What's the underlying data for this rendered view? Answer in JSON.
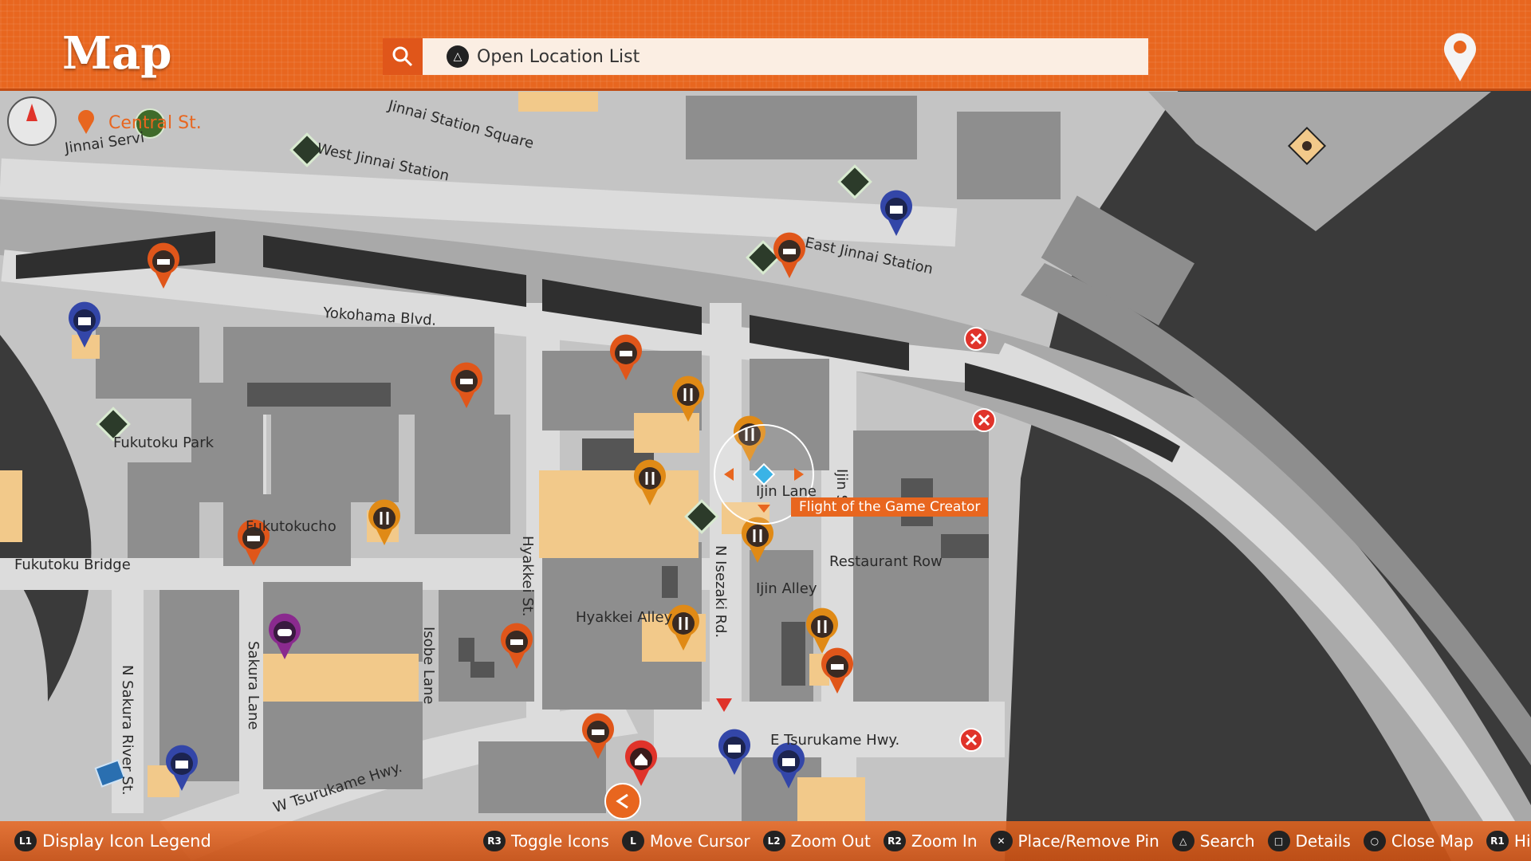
{
  "header": {
    "title": "Map",
    "search_label": "Open Location List",
    "search_button_glyph": "△"
  },
  "current_location": "Central St.",
  "destination_label": "Flight of the Game Creator",
  "streets": {
    "jinnai_station_square": "Jinnai Station Square",
    "west_jinnai_station": "West Jinnai Station",
    "east_jinnai_station": "East Jinnai Station",
    "jinnai_service": "Jinnai Servi",
    "yokohama_blvd": "Yokohama Blvd.",
    "fukutoku_park": "Fukutoku Park",
    "fukutokucho": "Fukutokucho",
    "fukutoku_bridge": "Fukutoku Bridge",
    "hyakkei_st": "Hyakkei St.",
    "hyakkei_alley": "Hyakkei Alley",
    "n_isezaki_rd": "N Isezaki Rd.",
    "ijin_lane": "Ijin Lane",
    "ijin_st": "Ijin St.",
    "restaurant_row": "Restaurant Row",
    "ijin_alley": "Ijin Alley",
    "sakura_lane": "Sakura Lane",
    "isobe_lane": "Isobe Lane",
    "n_sakura_river_st": "N Sakura River St.",
    "e_tsurukame_hwy": "E Tsurukame Hwy.",
    "w_tsurukame_hwy": "W Tsurukame Hwy."
  },
  "footer": {
    "legend": {
      "glyph": "L1",
      "label": "Display Icon Legend"
    },
    "controls": [
      {
        "glyph": "R3",
        "label": "Toggle Icons"
      },
      {
        "glyph": "L",
        "label": "Move Cursor"
      },
      {
        "glyph": "L2",
        "label": "Zoom Out"
      },
      {
        "glyph": "R2",
        "label": "Zoom In"
      },
      {
        "glyph": "✕",
        "label": "Place/Remove Pin"
      },
      {
        "glyph": "△",
        "label": "Search"
      },
      {
        "glyph": "□",
        "label": "Details"
      },
      {
        "glyph": "○",
        "label": "Close Map"
      },
      {
        "glyph": "R1",
        "label": "Hide Controls"
      }
    ]
  },
  "colors": {
    "accent": "#e8661f",
    "water": "#3a3a3a",
    "land": "#c4c4c4",
    "road": "#dcdcdc",
    "building": "#8e8e8e",
    "highlight_building": "#f2c98a",
    "pin_shop": "#3346a8",
    "pin_restaurant": "#e08a16",
    "pin_taxi": "#e0561a",
    "pin_game": "#8a2a8e",
    "pin_talk": "#d8ead0",
    "no_entry": "#e0332a"
  },
  "pins": [
    {
      "type": "taxi",
      "icon": "taxi-icon"
    },
    {
      "type": "taxi",
      "icon": "taxi-icon"
    },
    {
      "type": "taxi",
      "icon": "taxi-icon"
    },
    {
      "type": "taxi",
      "icon": "taxi-icon"
    },
    {
      "type": "taxi",
      "icon": "taxi-icon"
    },
    {
      "type": "taxi",
      "icon": "taxi-icon"
    },
    {
      "type": "taxi",
      "icon": "taxi-icon"
    },
    {
      "type": "taxi",
      "icon": "taxi-icon"
    },
    {
      "type": "restaurant",
      "icon": "fork-knife-icon"
    },
    {
      "type": "restaurant",
      "icon": "fork-knife-icon"
    },
    {
      "type": "restaurant",
      "icon": "fork-knife-icon"
    },
    {
      "type": "restaurant",
      "icon": "fork-knife-icon"
    },
    {
      "type": "restaurant",
      "icon": "fork-knife-icon"
    },
    {
      "type": "restaurant",
      "icon": "fork-knife-icon"
    },
    {
      "type": "restaurant",
      "icon": "fork-knife-icon"
    },
    {
      "type": "shop",
      "icon": "basket-icon"
    },
    {
      "type": "shop",
      "icon": "basket-icon"
    },
    {
      "type": "shop",
      "icon": "basket-icon"
    },
    {
      "type": "shop",
      "icon": "basket-icon"
    },
    {
      "type": "shop",
      "icon": "basket-icon"
    },
    {
      "type": "game",
      "icon": "gamepad-icon"
    },
    {
      "type": "home",
      "icon": "house-icon"
    },
    {
      "type": "talk",
      "icon": "speech-bubble-icon"
    },
    {
      "type": "talk",
      "icon": "speech-bubble-icon"
    },
    {
      "type": "talk",
      "icon": "speech-bubble-icon"
    },
    {
      "type": "talk",
      "icon": "speech-bubble-icon"
    },
    {
      "type": "talk",
      "icon": "speech-bubble-icon"
    },
    {
      "type": "no-entry",
      "icon": "no-entry-icon"
    },
    {
      "type": "no-entry",
      "icon": "no-entry-icon"
    },
    {
      "type": "no-entry",
      "icon": "no-entry-icon"
    },
    {
      "type": "pet",
      "icon": "paw-icon"
    },
    {
      "type": "save",
      "icon": "save-icon"
    }
  ]
}
